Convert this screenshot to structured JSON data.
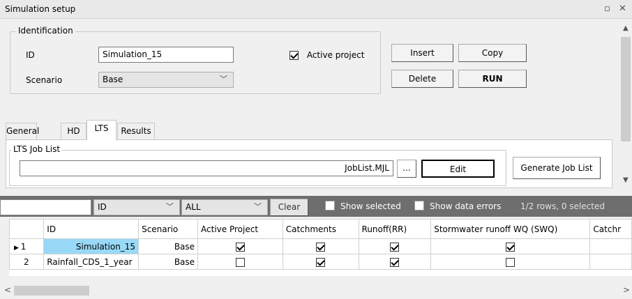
{
  "window": {
    "title": "Simulation setup"
  },
  "identification": {
    "legend": "Identification",
    "id_label": "ID",
    "id_value": "Simulation_15",
    "scenario_label": "Scenario",
    "scenario_value": "Base",
    "active_project_label": "Active project",
    "active_project_checked": true
  },
  "actions": {
    "insert": "Insert",
    "copy": "Copy",
    "delete": "Delete",
    "run": "RUN"
  },
  "tabs": [
    {
      "label": "General",
      "active": false
    },
    {
      "label": "HD",
      "active": false
    },
    {
      "label": "LTS",
      "active": true
    },
    {
      "label": "Results",
      "active": false
    }
  ],
  "lts": {
    "legend": "LTS Job List",
    "job_list_value": "JobList.MJL",
    "browse_label": "...",
    "edit_label": "Edit",
    "generate_label": "Generate Job List"
  },
  "filter": {
    "search_value": "",
    "field_value": "ID",
    "scope_value": "ALL",
    "clear_label": "Clear",
    "show_selected_label": "Show selected",
    "show_errors_label": "Show data errors",
    "status": "1/2 rows, 0 selected"
  },
  "grid": {
    "columns": [
      "",
      "ID",
      "Scenario",
      "Active Project",
      "Catchments",
      "Runoff(RR)",
      "Stormwater runoff WQ (SWQ)",
      "Catchr"
    ],
    "rows": [
      {
        "num": "1",
        "id": "Simulation_15",
        "scenario": "Base",
        "active": true,
        "catchments": true,
        "runoff": true,
        "swq": true,
        "current": true
      },
      {
        "num": "2",
        "id": "Rainfall_CDS_1_year",
        "scenario": "Base",
        "active": false,
        "catchments": true,
        "runoff": true,
        "swq": false,
        "current": false
      }
    ]
  },
  "colors": {
    "filter_bar": "#6e6e6e",
    "selected_cell": "#99d9f8",
    "panel": "#f0f0f0"
  }
}
